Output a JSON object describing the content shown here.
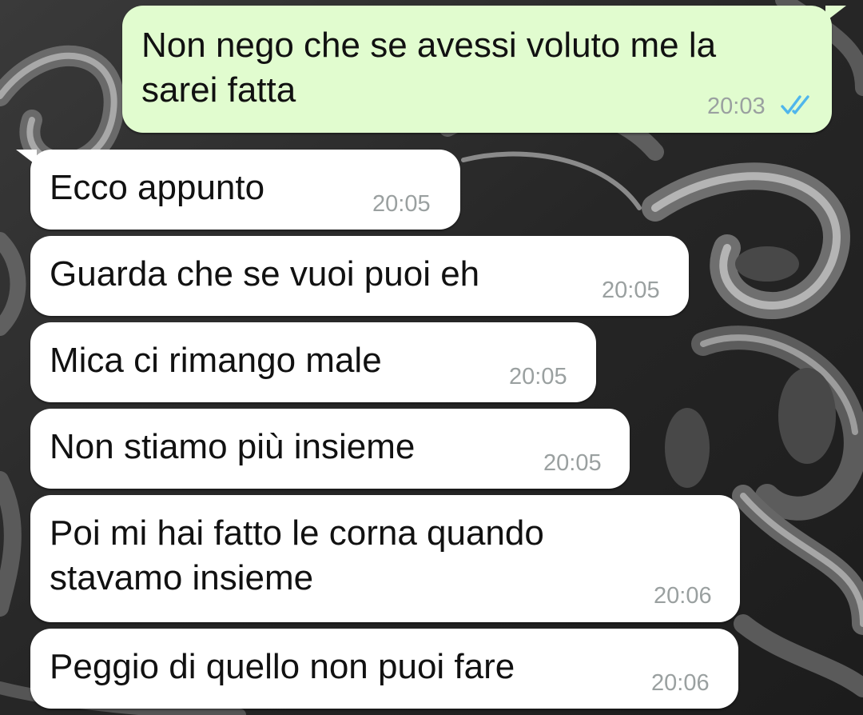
{
  "colors": {
    "outgoing_bubble": "#e1fccf",
    "incoming_bubble": "#ffffff",
    "timestamp": "#9aa0a0",
    "read_ticks": "#4fb6ec"
  },
  "messages": [
    {
      "direction": "outgoing",
      "text": "Non nego che se avessi voluto me la\nsarei fatta",
      "time": "20:03",
      "status_icon": "double-check-read-icon"
    },
    {
      "direction": "incoming",
      "text": "Ecco appunto",
      "time": "20:05"
    },
    {
      "direction": "incoming",
      "text": "Guarda che se vuoi puoi eh",
      "time": "20:05"
    },
    {
      "direction": "incoming",
      "text": "Mica ci rimango male",
      "time": "20:05"
    },
    {
      "direction": "incoming",
      "text": "Non stiamo più insieme",
      "time": "20:05"
    },
    {
      "direction": "incoming",
      "text": "Poi mi hai fatto le corna quando\nstavamo insieme",
      "time": "20:06"
    },
    {
      "direction": "incoming",
      "text": "Peggio di quello non puoi fare",
      "time": "20:06"
    }
  ]
}
